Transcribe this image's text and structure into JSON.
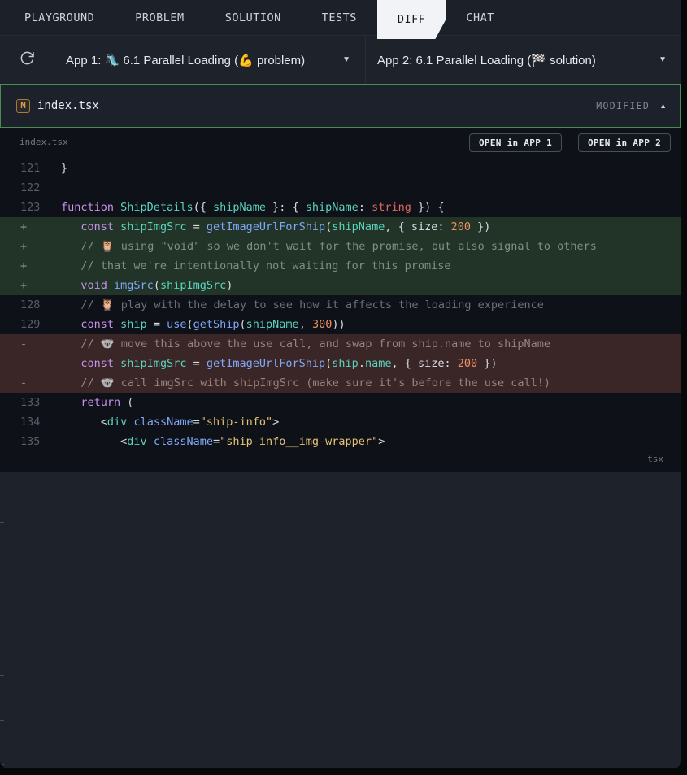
{
  "tabs": {
    "items": [
      {
        "label": "PLAYGROUND",
        "active": false
      },
      {
        "label": "PROBLEM",
        "active": false
      },
      {
        "label": "SOLUTION",
        "active": false
      },
      {
        "label": "TESTS",
        "active": false
      },
      {
        "label": "DIFF",
        "active": true
      },
      {
        "label": "CHAT",
        "active": false
      }
    ]
  },
  "toolbar": {
    "refresh_icon": "refresh-circular-arrow",
    "app1_label": "App 1: 🛝 6.1 Parallel Loading (💪 problem)",
    "app2_label": "App 2: 6.1 Parallel Loading (🏁 solution)",
    "caret_down": "▼"
  },
  "file_header": {
    "badge": "M",
    "filename": "index.tsx",
    "status": "MODIFIED",
    "collapse_arrow": "▲"
  },
  "code_panel": {
    "filename_label": "index.tsx",
    "open_app1_button": "OPEN in APP 1",
    "open_app2_button": "OPEN in APP 2",
    "language_badge": "tsx"
  },
  "colors": {
    "accent_green_border": "#4a8c50",
    "added_row_bg": "#223428",
    "removed_row_bg": "#3a2527",
    "modified_badge": "#d79d45",
    "active_tab_bg": "#f2f3f6"
  },
  "code_lines": [
    {
      "gutter": "121",
      "type": "ctx",
      "tokens": [
        [
          "pun",
          "}"
        ]
      ]
    },
    {
      "gutter": "122",
      "type": "ctx",
      "tokens": []
    },
    {
      "gutter": "123",
      "type": "ctx",
      "tokens": [
        [
          "kw",
          "function"
        ],
        [
          "pun",
          " "
        ],
        [
          "ent",
          "ShipDetails"
        ],
        [
          "pun",
          "({ "
        ],
        [
          "ent",
          "shipName"
        ],
        [
          "pun",
          " }: { "
        ],
        [
          "ent",
          "shipName"
        ],
        [
          "pun",
          ": "
        ],
        [
          "typ",
          "string"
        ],
        [
          "pun",
          " }) {"
        ]
      ]
    },
    {
      "gutter": "+",
      "type": "add",
      "tokens": [
        [
          "pun",
          "\t"
        ],
        [
          "kw",
          "const"
        ],
        [
          "pun",
          " "
        ],
        [
          "ent",
          "shipImgSrc"
        ],
        [
          "pun",
          " = "
        ],
        [
          "fn",
          "getImageUrlForShip"
        ],
        [
          "pun",
          "("
        ],
        [
          "ent",
          "shipName"
        ],
        [
          "pun",
          ", { size: "
        ],
        [
          "num",
          "200"
        ],
        [
          "pun",
          " })"
        ]
      ]
    },
    {
      "gutter": "+",
      "type": "add",
      "tokens": [
        [
          "cmt",
          "\t// 🦉 using \"void\" so we don't wait for the promise, but also signal to others"
        ]
      ]
    },
    {
      "gutter": "+",
      "type": "add",
      "tokens": [
        [
          "cmt",
          "\t// that we're intentionally not waiting for this promise"
        ]
      ]
    },
    {
      "gutter": "+",
      "type": "add",
      "tokens": [
        [
          "pun",
          "\t"
        ],
        [
          "kw",
          "void"
        ],
        [
          "pun",
          " "
        ],
        [
          "fn",
          "imgSrc"
        ],
        [
          "pun",
          "("
        ],
        [
          "ent",
          "shipImgSrc"
        ],
        [
          "pun",
          ")"
        ]
      ]
    },
    {
      "gutter": "128",
      "type": "ctx",
      "tokens": [
        [
          "cmt",
          "\t// 🦉 play with the delay to see how it affects the loading experience"
        ]
      ]
    },
    {
      "gutter": "129",
      "type": "ctx",
      "tokens": [
        [
          "pun",
          "\t"
        ],
        [
          "kw",
          "const"
        ],
        [
          "pun",
          " "
        ],
        [
          "ent",
          "ship"
        ],
        [
          "pun",
          " = "
        ],
        [
          "fn",
          "use"
        ],
        [
          "pun",
          "("
        ],
        [
          "fn",
          "getShip"
        ],
        [
          "pun",
          "("
        ],
        [
          "ent",
          "shipName"
        ],
        [
          "pun",
          ", "
        ],
        [
          "num",
          "300"
        ],
        [
          "pun",
          "))"
        ]
      ]
    },
    {
      "gutter": "-",
      "type": "rem",
      "tokens": [
        [
          "cmt",
          "\t// 🐨 move this above the use call, and swap from ship.name to shipName"
        ]
      ]
    },
    {
      "gutter": "-",
      "type": "rem",
      "tokens": [
        [
          "pun",
          "\t"
        ],
        [
          "kw",
          "const"
        ],
        [
          "pun",
          " "
        ],
        [
          "ent",
          "shipImgSrc"
        ],
        [
          "pun",
          " = "
        ],
        [
          "fn",
          "getImageUrlForShip"
        ],
        [
          "pun",
          "("
        ],
        [
          "ent",
          "ship"
        ],
        [
          "pun",
          "."
        ],
        [
          "ent",
          "name"
        ],
        [
          "pun",
          ", { size: "
        ],
        [
          "num",
          "200"
        ],
        [
          "pun",
          " })"
        ]
      ]
    },
    {
      "gutter": "-",
      "type": "rem",
      "tokens": [
        [
          "cmt",
          "\t// 🐨 call imgSrc with shipImgSrc (make sure it's before the use call!)"
        ]
      ]
    },
    {
      "gutter": "133",
      "type": "ctx",
      "tokens": [
        [
          "pun",
          "\t"
        ],
        [
          "kw",
          "return"
        ],
        [
          "pun",
          " ("
        ]
      ]
    },
    {
      "gutter": "134",
      "type": "ctx",
      "tokens": [
        [
          "pun",
          "\t\t<"
        ],
        [
          "ent",
          "div"
        ],
        [
          "pun",
          " "
        ],
        [
          "fn",
          "className"
        ],
        [
          "pun",
          "="
        ],
        [
          "str",
          "\"ship-info\""
        ],
        [
          "pun",
          ">"
        ]
      ]
    },
    {
      "gutter": "135",
      "type": "ctx",
      "tokens": [
        [
          "pun",
          "\t\t\t<"
        ],
        [
          "ent",
          "div"
        ],
        [
          "pun",
          " "
        ],
        [
          "fn",
          "className"
        ],
        [
          "pun",
          "="
        ],
        [
          "str",
          "\"ship-info__img-wrapper\""
        ],
        [
          "pun",
          ">"
        ]
      ]
    }
  ]
}
